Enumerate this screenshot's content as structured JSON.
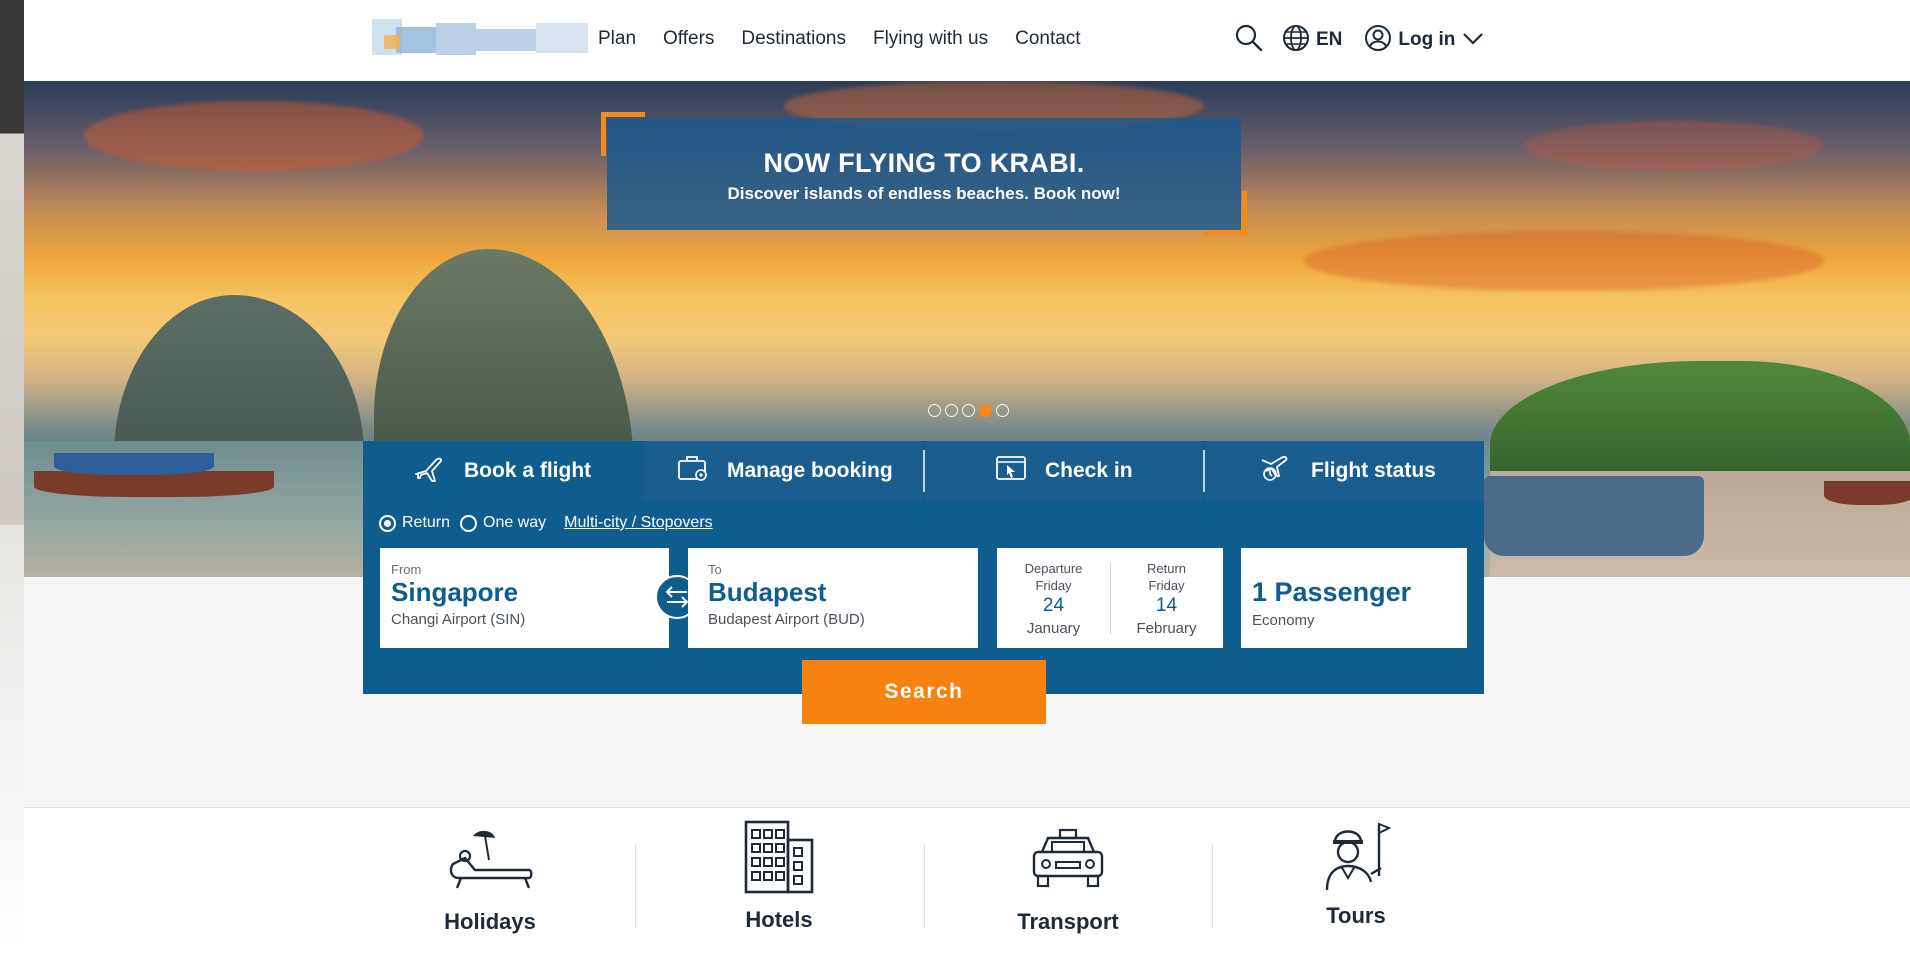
{
  "header": {
    "nav": [
      "Plan",
      "Offers",
      "Destinations",
      "Flying with us",
      "Contact"
    ],
    "language": "EN",
    "login_label": "Log in"
  },
  "hero": {
    "promo_title": "NOW FLYING TO KRABI.",
    "promo_subtitle": "Discover islands of endless beaches. Book now!",
    "carousel_active_index": 4,
    "carousel_count": 5
  },
  "booking": {
    "tabs": [
      "Book a flight",
      "Manage booking",
      "Check in",
      "Flight status"
    ],
    "trip_types": [
      "Return",
      "One way"
    ],
    "selected_trip_type": "Return",
    "multicity_link": "Multi-city / Stopovers",
    "from": {
      "label": "From",
      "city": "Singapore",
      "airport": "Changi Airport (SIN)"
    },
    "to": {
      "label": "To",
      "city": "Budapest",
      "airport": "Budapest Airport (BUD)"
    },
    "departure": {
      "label": "Departure",
      "weekday": "Friday",
      "day": "24",
      "month": "January"
    },
    "return": {
      "label": "Return",
      "weekday": "Friday",
      "day": "14",
      "month": "February"
    },
    "passengers": "1 Passenger",
    "cabin": "Economy",
    "search_label": "Search"
  },
  "categories": [
    "Holidays",
    "Hotels",
    "Transport",
    "Tours"
  ],
  "colors": {
    "brand_blue": "#0f5c8f",
    "accent_orange": "#f6830f"
  },
  "icons": [
    "search-icon",
    "globe-icon",
    "user-icon",
    "chevron-down-icon",
    "plane-icon",
    "briefcase-icon",
    "checkin-icon",
    "flight-status-icon",
    "swap-icon",
    "sunbed-icon",
    "hotel-icon",
    "car-icon",
    "guide-icon"
  ]
}
